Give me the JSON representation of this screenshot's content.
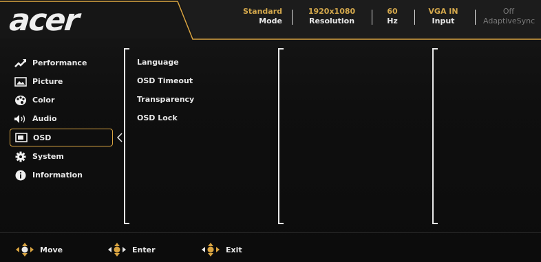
{
  "brand": {
    "logo_text": "acer"
  },
  "status_bar": [
    {
      "top": "Standard",
      "bottom": "Mode",
      "disabled": false
    },
    {
      "top": "1920x1080",
      "bottom": "Resolution",
      "disabled": false
    },
    {
      "top": "60",
      "bottom": "Hz",
      "disabled": false
    },
    {
      "top": "VGA IN",
      "bottom": "Input",
      "disabled": false
    },
    {
      "top": "Off",
      "bottom": "AdaptiveSync",
      "disabled": true
    }
  ],
  "menu": {
    "items": [
      {
        "label": "Performance",
        "icon": "performance-icon"
      },
      {
        "label": "Picture",
        "icon": "picture-icon"
      },
      {
        "label": "Color",
        "icon": "palette-icon"
      },
      {
        "label": "Audio",
        "icon": "speaker-icon"
      },
      {
        "label": "OSD",
        "icon": "osd-icon"
      },
      {
        "label": "System",
        "icon": "gear-icon"
      },
      {
        "label": "Information",
        "icon": "info-icon"
      }
    ],
    "selected": "OSD"
  },
  "submenu": {
    "items": [
      {
        "label": "Language"
      },
      {
        "label": "OSD Timeout"
      },
      {
        "label": "Transparency"
      },
      {
        "label": "OSD Lock"
      }
    ]
  },
  "footer": {
    "items": [
      {
        "label": "Move",
        "icon": "dpad-move-icon"
      },
      {
        "label": "Enter",
        "icon": "dpad-enter-icon"
      },
      {
        "label": "Exit",
        "icon": "dpad-exit-icon"
      }
    ]
  },
  "colors": {
    "accent": "#d9a441",
    "text": "#e8e8e8",
    "background": "#0f0f0f"
  }
}
